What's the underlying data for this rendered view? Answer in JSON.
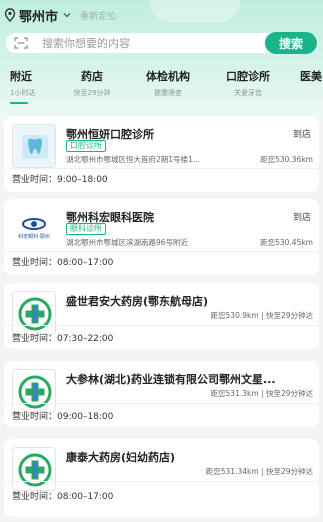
{
  "location": {
    "city": "鄂州市",
    "relocate_label": "重新定位"
  },
  "search": {
    "placeholder": "搜索你想要的内容",
    "button_label": "搜索"
  },
  "tabs": [
    {
      "label": "附近",
      "sub": "1小时达"
    },
    {
      "label": "药店",
      "sub": "快至29分钟"
    },
    {
      "label": "体检机构",
      "sub": "健康筛查"
    },
    {
      "label": "口腔诊所",
      "sub": "关爱牙齿"
    },
    {
      "label": "医美",
      "sub": ""
    }
  ],
  "listings": [
    {
      "name": "鄂州恒妍口腔诊所",
      "tag": "口腔诊所",
      "address": "湖北鄂州市鄂城区恒大首府2期1号楼1...",
      "distance": "距您530.36km",
      "action": "到店",
      "hours_label": "营业时间：",
      "hours": "9:00–18:00"
    },
    {
      "name": "鄂州科宏眼科医院",
      "tag": "眼科诊所",
      "address": "湖北鄂州市鄂城区滨湖南路96号附近",
      "distance": "距您530.45km",
      "action": "到店",
      "hours_label": "营业时间：",
      "hours": "08:00–17:00",
      "logo_text": "科宏眼科·鄂州"
    },
    {
      "name": "盛世君安大药房(鄂东航母店)",
      "distance": "距您530.9km | 快至29分钟达",
      "hours_label": "营业时间：",
      "hours": "07:30–22:00"
    },
    {
      "name": "大参林(湖北)药业连锁有限公司鄂州文星...",
      "distance": "距您531.3km | 快至29分钟达",
      "hours_label": "营业时间：",
      "hours": "09:00–18:00"
    },
    {
      "name": "康泰大药房(妇幼药店)",
      "distance": "距您531.34km | 快至29分钟达",
      "hours_label": "营业时间：",
      "hours": "08:00–17:00"
    }
  ],
  "colors": {
    "accent": "#19b58a",
    "header_bg": "#bfeede"
  }
}
